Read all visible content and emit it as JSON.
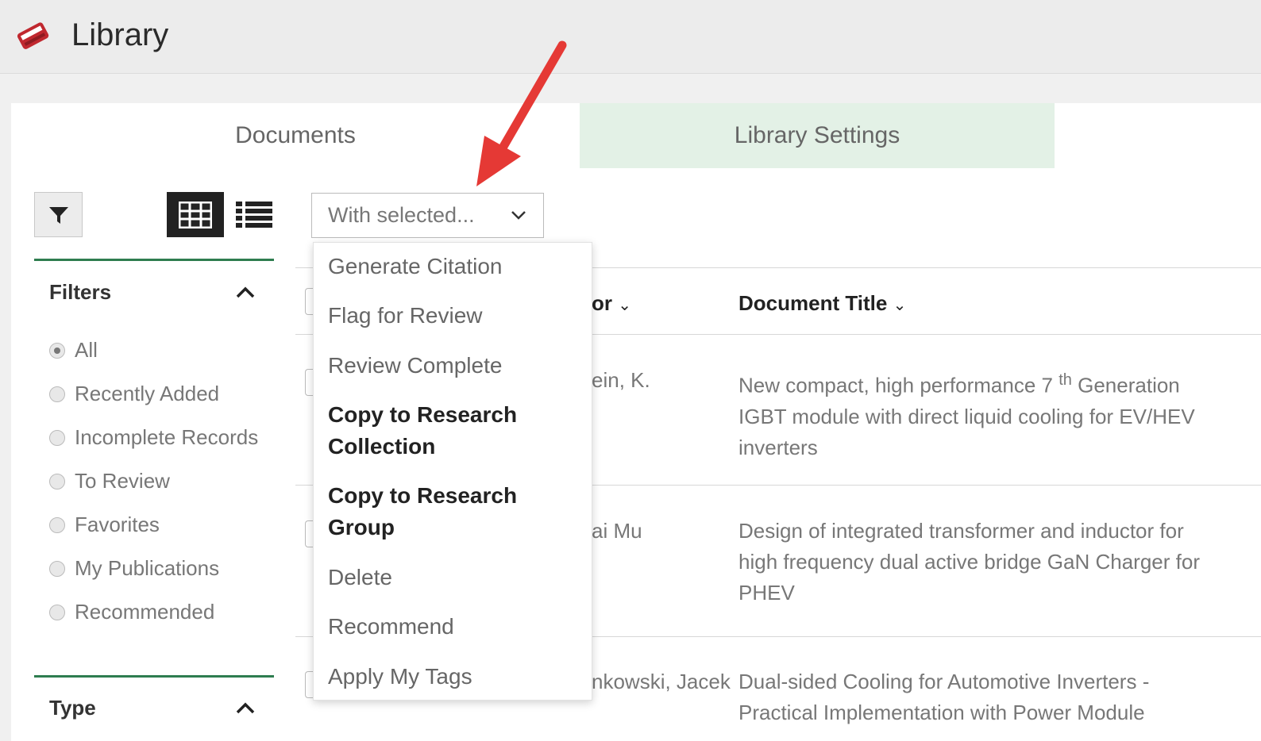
{
  "header": {
    "title": "Library",
    "icon": "book-icon"
  },
  "tabs": {
    "documents": "Documents",
    "settings": "Library Settings"
  },
  "toolbar": {
    "filter_icon": "filter-icon",
    "grid_icon": "grid-view-icon",
    "list_icon": "list-view-icon",
    "with_selected": "With selected..."
  },
  "dropdown": {
    "items": [
      "Generate Citation",
      "Flag for Review",
      "Review Complete",
      "Copy to Research Collection",
      "Copy to Research Group",
      "Delete",
      "Recommend",
      "Apply My Tags"
    ]
  },
  "sidebar": {
    "filters_title": "Filters",
    "filters": [
      "All",
      "Recently Added",
      "Incomplete Records",
      "To Review",
      "Favorites",
      "My Publications",
      "Recommended"
    ],
    "selected": "All",
    "type_title": "Type"
  },
  "table": {
    "author_header_fragment": "or",
    "title_header": "Document Title",
    "rows": [
      {
        "author": "ein, K.",
        "title_a": "New compact, high performance 7",
        "title_sup": "th",
        "title_b": "Generation",
        "title_line2": "IGBT module with direct liquid cooling for EV/HEV",
        "title_line3": "inverters"
      },
      {
        "author": "ai Mu",
        "title_line1": "Design of integrated transformer and inductor for",
        "title_line2": "high frequency dual active bridge GaN Charger for",
        "title_line3": "PHEV"
      },
      {
        "author": "nkowski, Jacek",
        "title_line1": "Dual-sided Cooling for Automotive Inverters -",
        "title_line2": "Practical Implementation with Power Module"
      }
    ]
  },
  "colors": {
    "accent_green": "#2e7d4f",
    "settings_tab_bg": "#e3f1e6",
    "arrow_red": "#e53935",
    "icon_red": "#c0282f"
  }
}
